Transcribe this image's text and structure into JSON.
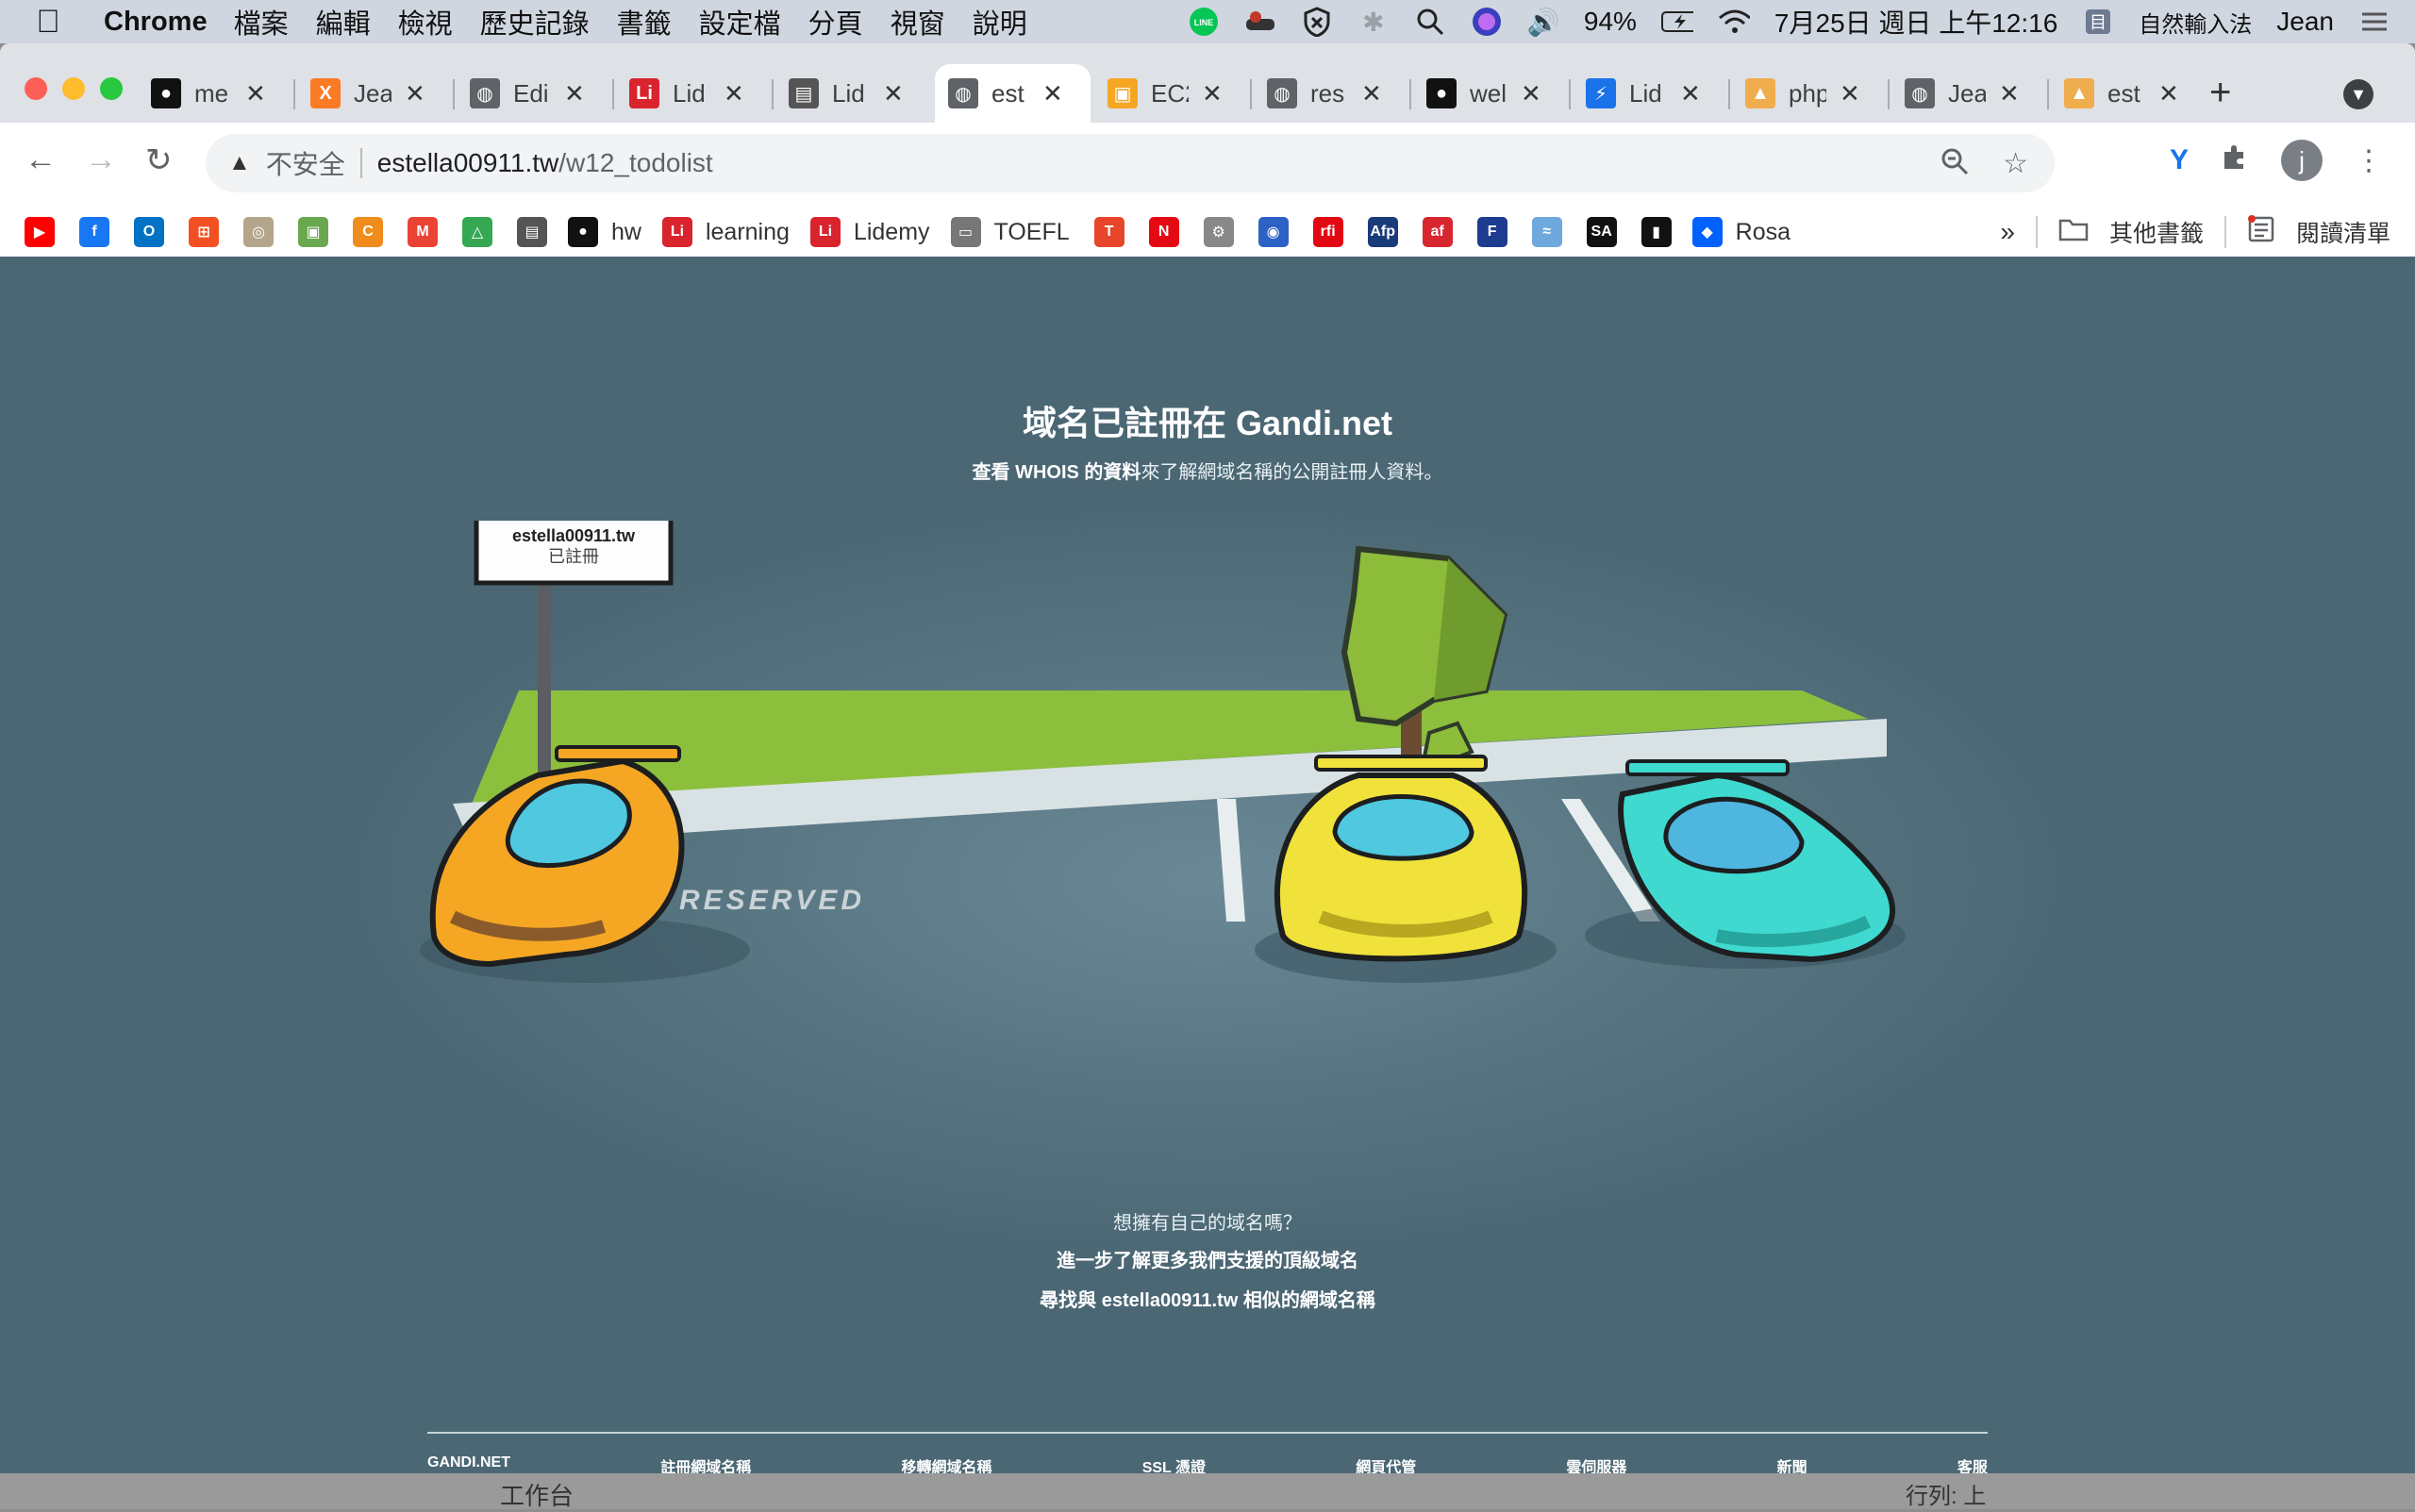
{
  "menubar": {
    "app": "Chrome",
    "menus": [
      "檔案",
      "編輯",
      "檢視",
      "歷史記錄",
      "書籤",
      "設定檔",
      "分頁",
      "視窗",
      "說明"
    ],
    "battery": "94%",
    "clock": "7月25日 週日 上午12:16",
    "input_method": "自然輸入法",
    "user": "Jean"
  },
  "tabs": [
    {
      "title": "me",
      "icon": "github-icon"
    },
    {
      "title": "Jea",
      "icon": "xampp-icon"
    },
    {
      "title": "Edi",
      "icon": "globe-icon"
    },
    {
      "title": "Lid",
      "icon": "lidemy-icon"
    },
    {
      "title": "Lid",
      "icon": "document-icon"
    },
    {
      "title": "est",
      "icon": "globe-icon",
      "active": true
    },
    {
      "title": "EC2",
      "icon": "aws-icon"
    },
    {
      "title": "res",
      "icon": "globe-icon"
    },
    {
      "title": "wel",
      "icon": "github-icon"
    },
    {
      "title": "Lid",
      "icon": "bolt-icon"
    },
    {
      "title": "php",
      "icon": "pma-icon"
    },
    {
      "title": "Jea",
      "icon": "globe-icon"
    },
    {
      "title": "est",
      "icon": "pma-icon"
    }
  ],
  "address": {
    "security_label": "不安全",
    "host": "estella00911.tw",
    "path": "/w12_todolist"
  },
  "profile_initial": "j",
  "bookmarks": {
    "items": [
      {
        "label": "",
        "icon": "youtube-icon",
        "color": "#ff0000"
      },
      {
        "label": "",
        "icon": "facebook-icon",
        "color": "#1877f2"
      },
      {
        "label": "",
        "icon": "outlook-icon",
        "color": "#0072c6"
      },
      {
        "label": "",
        "icon": "microsoft-icon",
        "color": "#f25022"
      },
      {
        "label": "",
        "icon": "university-seal-icon",
        "color": "#b5a58a"
      },
      {
        "label": "",
        "icon": "green-app-icon",
        "color": "#6aa84f"
      },
      {
        "label": "",
        "icon": "orange-c-icon",
        "color": "#f08c1b"
      },
      {
        "label": "",
        "icon": "gmail-icon",
        "color": "#ea4335"
      },
      {
        "label": "",
        "icon": "drive-icon",
        "color": "#34a853"
      },
      {
        "label": "",
        "icon": "document-icon",
        "color": "#555555"
      },
      {
        "label": "hw",
        "icon": "github-icon",
        "color": "#111111"
      },
      {
        "label": "learning",
        "icon": "lidemy-icon",
        "color": "#d9232d"
      },
      {
        "label": "Lidemy",
        "icon": "lidemy-icon",
        "color": "#d9232d"
      },
      {
        "label": "TOEFL",
        "icon": "folder-icon",
        "color": "#777777"
      },
      {
        "label": "",
        "icon": "t-icon",
        "color": "#e8462a"
      },
      {
        "label": "",
        "icon": "netflix-icon",
        "color": "#e50914"
      },
      {
        "label": "",
        "icon": "gear-icon",
        "color": "#888888"
      },
      {
        "label": "",
        "icon": "radio-icon",
        "color": "#2b62c4"
      },
      {
        "label": "",
        "icon": "rfi-icon",
        "color": "#e30613"
      },
      {
        "label": "",
        "icon": "afp-icon",
        "color": "#1a3b7a"
      },
      {
        "label": "",
        "icon": "af-icon",
        "color": "#d8262f"
      },
      {
        "label": "",
        "icon": "f-icon",
        "color": "#1d3b8f"
      },
      {
        "label": "",
        "icon": "wave-icon",
        "color": "#6fa8dc"
      },
      {
        "label": "",
        "icon": "sa-icon",
        "color": "#111111"
      },
      {
        "label": "",
        "icon": "black-square-icon",
        "color": "#111111"
      },
      {
        "label": "Rosa",
        "icon": "dropbox-icon",
        "color": "#0061fe"
      }
    ],
    "more": "»",
    "other": "其他書籤",
    "reading_list": "閱讀清單"
  },
  "page": {
    "headline": "域名已註冊在 Gandi.net",
    "sub_strong": "查看 WHOIS 的資料",
    "sub_rest": "來了解網域名稱的公開註冊人資料。",
    "sign_domain": "estella00911.tw",
    "sign_status": "已註冊",
    "reserved": "RESERVED",
    "cta_question": "想擁有自己的域名嗎？",
    "cta_link1": "進一步了解更多我們支援的頂級域名",
    "cta_link2": "尋找與 estella00911.tw 相似的網域名稱",
    "footer": [
      "GANDI.NET",
      "註冊網域名稱",
      "移轉網域名稱",
      "SSL 憑證",
      "網頁代管",
      "雲伺服器",
      "新聞",
      "客服"
    ]
  },
  "behind": {
    "left_text": "工作台",
    "right_text": "行列: 上"
  },
  "colors": {
    "page_bg": "#4b6774",
    "car_orange": "#f5a623",
    "car_yellow": "#f0e23a",
    "car_teal": "#3fd9d0",
    "tree": "#8dbb3a"
  }
}
